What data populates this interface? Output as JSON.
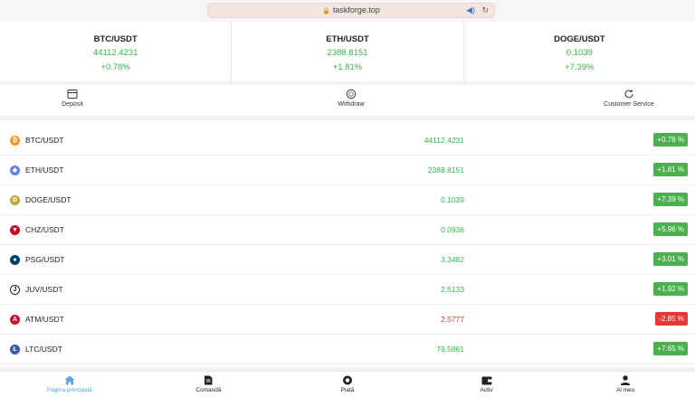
{
  "browser": {
    "url": "taskforge.top"
  },
  "tickers": [
    {
      "symbol": "BTC/USDT",
      "price": "44112.4231",
      "change": "+0.78%"
    },
    {
      "symbol": "ETH/USDT",
      "price": "2388.8151",
      "change": "+1.81%"
    },
    {
      "symbol": "DOGE/USDT",
      "price": "0.1039",
      "change": "+7.39%"
    }
  ],
  "actions": {
    "deposit": "Deposit",
    "withdraw": "Withdraw",
    "customer_service": "Customer Service"
  },
  "market": [
    {
      "pair": "BTC/USDT",
      "price": "44112.4231",
      "change": "+0.78 %",
      "dir": "up",
      "icon": "bitcoin-icon",
      "color": "#f7931a",
      "glyph": "₿"
    },
    {
      "pair": "ETH/USDT",
      "price": "2388.8151",
      "change": "+1.81 %",
      "dir": "up",
      "icon": "ethereum-icon",
      "color": "#627eea",
      "glyph": "◆"
    },
    {
      "pair": "DOGE/USDT",
      "price": "0.1039",
      "change": "+7.39 %",
      "dir": "up",
      "icon": "dogecoin-icon",
      "color": "#c2a633",
      "glyph": "Ð"
    },
    {
      "pair": "CHZ/USDT",
      "price": "0.0936",
      "change": "+5.96 %",
      "dir": "up",
      "icon": "chiliz-icon",
      "color": "#cd0124",
      "glyph": "▼"
    },
    {
      "pair": "PSG/USDT",
      "price": "3.3482",
      "change": "+3.01 %",
      "dir": "up",
      "icon": "psg-icon",
      "color": "#004170",
      "glyph": "●"
    },
    {
      "pair": "JUV/USDT",
      "price": "2.5133",
      "change": "+1.92 %",
      "dir": "up",
      "icon": "juventus-icon",
      "color": "#222222",
      "glyph": "J"
    },
    {
      "pair": "ATM/USDT",
      "price": "2.5777",
      "change": "-2.85 %",
      "dir": "down",
      "icon": "atletico-icon",
      "color": "#c8102e",
      "glyph": "A"
    },
    {
      "pair": "LTC/USDT",
      "price": "79.5861",
      "change": "+7.65 %",
      "dir": "up",
      "icon": "litecoin-icon",
      "color": "#345d9d",
      "glyph": "Ł"
    }
  ],
  "tabbar": [
    {
      "label": "Pagina principală",
      "icon": "home-icon",
      "active": true
    },
    {
      "label": "Comandă",
      "icon": "document-icon",
      "active": false
    },
    {
      "label": "Piață",
      "icon": "market-icon",
      "active": false
    },
    {
      "label": "Activ",
      "icon": "wallet-icon",
      "active": false
    },
    {
      "label": "Al meu",
      "icon": "user-icon",
      "active": false
    }
  ]
}
